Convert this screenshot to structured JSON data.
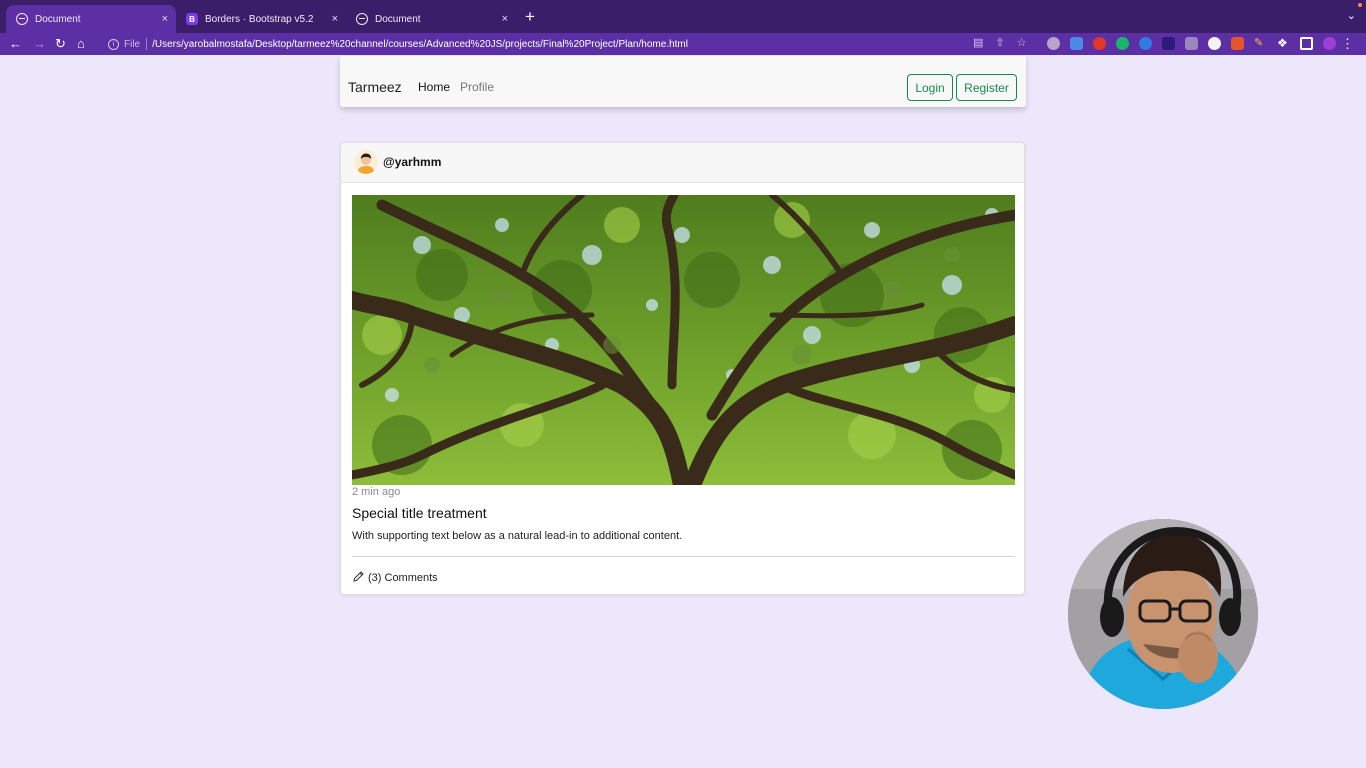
{
  "browser": {
    "tabs": [
      {
        "title": "Document",
        "active": true,
        "icon": "globe-icon"
      },
      {
        "title": "Borders · Bootstrap v5.2",
        "active": false,
        "icon": "bootstrap-icon"
      },
      {
        "title": "Document",
        "active": false,
        "icon": "globe-icon"
      }
    ],
    "close_glyph": "×",
    "new_tab_glyph": "+",
    "address": {
      "scheme": "File",
      "url": "/Users/yarobalmostafa/Desktop/tarmeez%20channel/courses/Advanced%20JS/projects/Final%20Project/Plan/home.html"
    },
    "colors": {
      "tabstrip": "#3a1e69",
      "toolbar": "#5c2fa4"
    }
  },
  "navbar": {
    "brand": "Tarmeez",
    "links": [
      {
        "label": "Home",
        "active": true
      },
      {
        "label": "Profile",
        "active": false
      }
    ],
    "buttons": {
      "login": "Login",
      "register": "Register"
    },
    "accent_color": "#198754"
  },
  "post": {
    "username": "@yarhmm",
    "time": "2 min ago",
    "title": "Special title treatment",
    "body": "With supporting text below as a natural lead-in to additional content.",
    "comments": "(3) Comments",
    "image": "tree-canopy-photo"
  },
  "page": {
    "background": "#ece7fb"
  }
}
